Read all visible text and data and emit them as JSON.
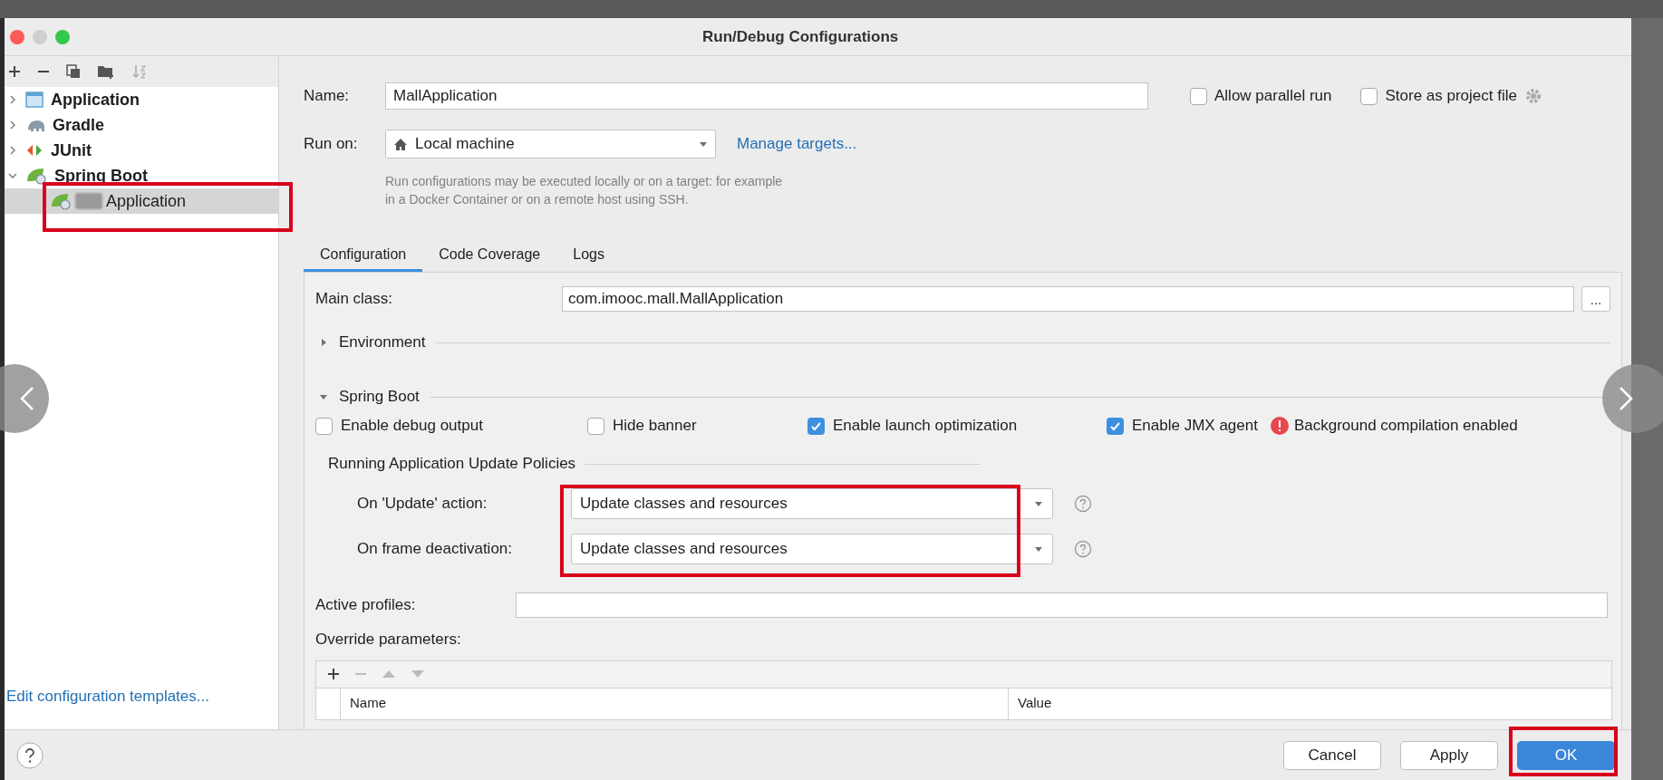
{
  "window": {
    "title": "Run/Debug Configurations"
  },
  "tree": [
    {
      "label": "Application",
      "kind": "application",
      "expanded": false
    },
    {
      "label": "Gradle",
      "kind": "gradle",
      "expanded": false
    },
    {
      "label": "JUnit",
      "kind": "junit",
      "expanded": false
    },
    {
      "label": "Spring Boot",
      "kind": "spring",
      "expanded": true,
      "children": [
        {
          "label": "Application",
          "kind": "spring-app",
          "selected": true
        }
      ]
    }
  ],
  "edit_templates": "Edit configuration templates...",
  "name": {
    "label": "Name:",
    "value": "MallApplication"
  },
  "options": [
    {
      "label": "Allow parallel run",
      "checked": false
    },
    {
      "label": "Store as project file",
      "checked": false
    }
  ],
  "run_on": {
    "label": "Run on:",
    "value": "Local machine",
    "link": "Manage targets..."
  },
  "hint": "Run configurations may be executed locally or on a target: for example in a Docker Container or on a remote host using SSH.",
  "tabs": [
    {
      "label": "Configuration",
      "selected": true
    },
    {
      "label": "Code Coverage",
      "selected": false
    },
    {
      "label": "Logs",
      "selected": false
    }
  ],
  "main_class": {
    "label": "Main class:",
    "value": "com.imooc.mall.MallApplication",
    "browse": "..."
  },
  "sections": [
    {
      "title": "Environment",
      "expanded": false
    },
    {
      "title": "Spring Boot",
      "expanded": true
    }
  ],
  "spring_boot_options": [
    {
      "label": "Enable debug output",
      "checked": false
    },
    {
      "label": "Hide banner",
      "checked": false
    },
    {
      "label": "Enable launch optimization",
      "checked": true
    },
    {
      "label": "Enable JMX agent",
      "checked": true
    }
  ],
  "warning": "Background compilation enabled",
  "policies": {
    "title": "Running Application Update Policies",
    "rows": [
      {
        "label": "On 'Update' action:",
        "value": "Update classes and resources"
      },
      {
        "label": "On frame deactivation:",
        "value": "Update classes and resources"
      }
    ]
  },
  "active_profiles": {
    "label": "Active profiles:"
  },
  "override": {
    "label": "Override parameters:",
    "columns": [
      "Name",
      "Value"
    ]
  },
  "buttons": [
    {
      "label": "Cancel",
      "kind": "secondary"
    },
    {
      "label": "Apply",
      "kind": "secondary"
    },
    {
      "label": "OK",
      "kind": "primary"
    }
  ]
}
